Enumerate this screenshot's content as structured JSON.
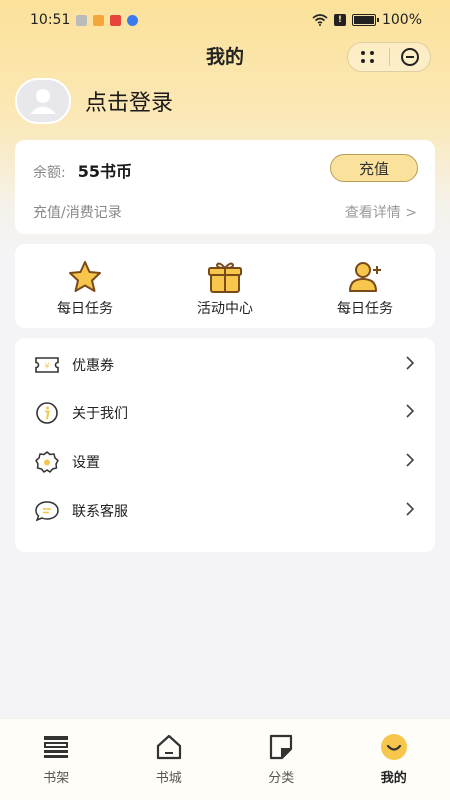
{
  "status_bar": {
    "time": "10:51",
    "battery": "100%",
    "battery_level": 1.0
  },
  "header": {
    "title": "我的"
  },
  "profile": {
    "login_text": "点击登录"
  },
  "balance": {
    "label": "余额:",
    "value": "55书币",
    "recharge_label": "充值",
    "records_label": "充值/消费记录",
    "details_label": "查看详情 >"
  },
  "quick_actions": [
    {
      "label": "每日任务",
      "icon": "star-icon"
    },
    {
      "label": "活动中心",
      "icon": "gift-icon"
    },
    {
      "label": "每日任务",
      "icon": "user-add-icon"
    }
  ],
  "menu": [
    {
      "label": "优惠券",
      "icon": "coupon-icon"
    },
    {
      "label": "关于我们",
      "icon": "info-icon"
    },
    {
      "label": "设置",
      "icon": "gear-icon"
    },
    {
      "label": "联系客服",
      "icon": "chat-icon"
    }
  ],
  "tabs": [
    {
      "label": "书架",
      "icon": "bookshelf-icon"
    },
    {
      "label": "书城",
      "icon": "home-icon"
    },
    {
      "label": "分类",
      "icon": "category-icon"
    },
    {
      "label": "我的",
      "icon": "smile-icon",
      "active": true
    }
  ],
  "colors": {
    "accent": "#fbe29c",
    "icon_brown": "#7a4a18",
    "icon_fill": "#f7c64c"
  }
}
